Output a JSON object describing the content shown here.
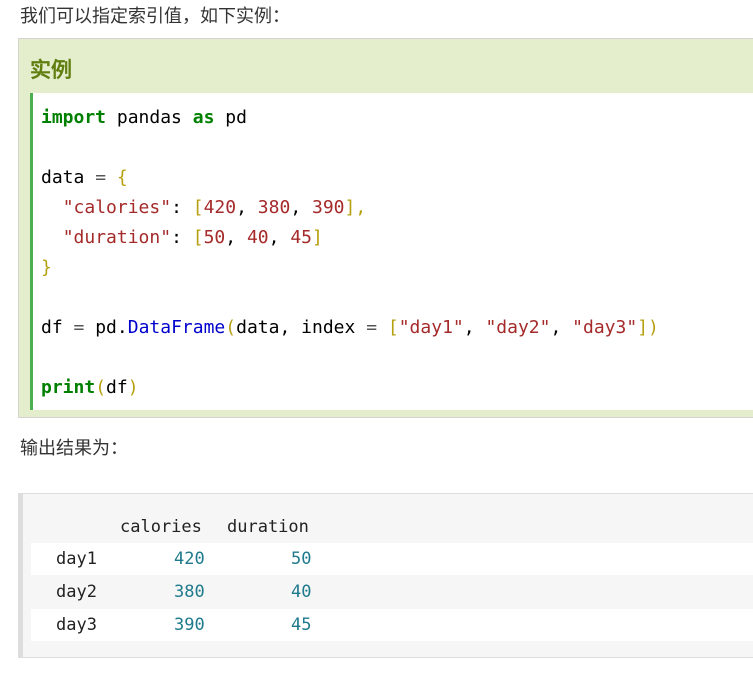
{
  "intro_text": "我们可以指定索引值，如下实例：",
  "example": {
    "title": "实例",
    "code": {
      "l1_import": "import",
      "l1_module": "pandas",
      "l1_as": "as",
      "l1_alias": "pd",
      "l3_var": "data",
      "l3_eq": "=",
      "l3_open": "{",
      "l4_key": "\"calories\"",
      "l4_colon": ":",
      "l4_open": "[",
      "l4_v1": "420",
      "l4_v2": "380",
      "l4_v3": "390",
      "l4_close": "],",
      "l5_key": "\"duration\"",
      "l5_colon": ":",
      "l5_open": "[",
      "l5_v1": "50",
      "l5_v2": "40",
      "l5_v3": "45",
      "l5_close": "]",
      "l6_close": "}",
      "l8_var": "df",
      "l8_eq": "=",
      "l8_mod": "pd.",
      "l8_fn": "DataFrame",
      "l8_paren": "(",
      "l8_arg": "data,",
      "l8_kwarg": "index",
      "l8_eq2": "=",
      "l8_lb": "[",
      "l8_s1": "\"day1\"",
      "l8_s2": "\"day2\"",
      "l8_s3": "\"day3\"",
      "l8_end": "])",
      "l10_fn": "print",
      "l10_paren": "(",
      "l10_arg": "df",
      "l10_end": ")"
    }
  },
  "output_label": "输出结果为：",
  "output_table": {
    "columns": [
      "calories",
      "duration"
    ],
    "rows": [
      {
        "index": "day1",
        "calories": "420",
        "duration": "50"
      },
      {
        "index": "day2",
        "calories": "380",
        "duration": "40"
      },
      {
        "index": "day3",
        "calories": "390",
        "duration": "45"
      }
    ]
  },
  "colors": {
    "keyword": "#008000",
    "function": "#0000cd",
    "string": "#a52a2a",
    "example_bg": "#e5eecc",
    "title": "#617f10",
    "output_number": "#1e7a8c"
  }
}
